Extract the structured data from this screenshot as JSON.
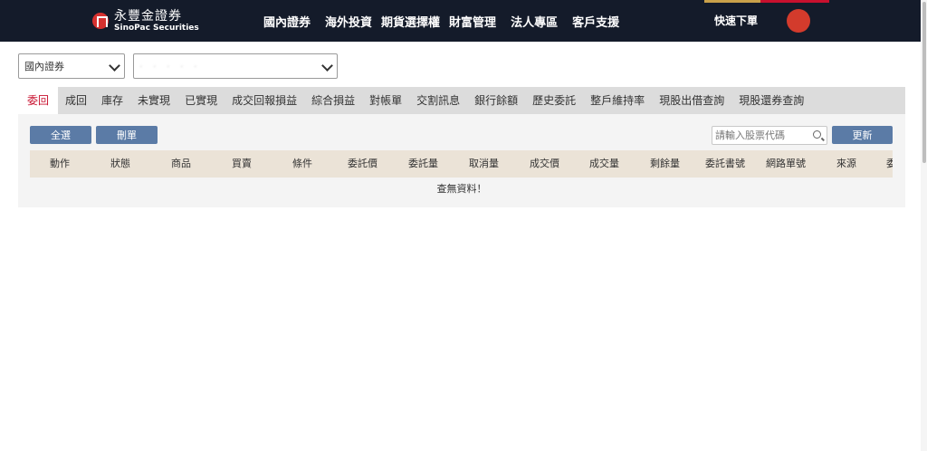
{
  "brand": {
    "name_cn": "永豐金證券",
    "name_en": "SinoPac Securities"
  },
  "nav": [
    "國內證券",
    "海外投資",
    "期貨選擇權",
    "財富管理",
    "法人專區",
    "客戶支援"
  ],
  "header_actions": {
    "quick_order": "快速下單"
  },
  "filters": {
    "market_value": "國內證券",
    "account_value": "·  ·  ·  ·  ·"
  },
  "tabs": [
    "委回",
    "成回",
    "庫存",
    "未實現",
    "已實現",
    "成交回報損益",
    "綜合損益",
    "對帳單",
    "交割訊息",
    "銀行餘額",
    "歷史委託",
    "整戶維持率",
    "現股出借查詢",
    "現股還券查詢"
  ],
  "toolbar": {
    "select_all": "全選",
    "delete": "刪單",
    "search_placeholder": "請輸入股票代碼",
    "refresh": "更新"
  },
  "table": {
    "columns": [
      "動作",
      "狀態",
      "商品",
      "買賣",
      "條件",
      "委託價",
      "委託量",
      "取消量",
      "成交價",
      "成交量",
      "剩餘量",
      "委託書號",
      "網路單號",
      "來源",
      "委"
    ],
    "empty_message": "查無資料！"
  },
  "colors": {
    "nav_bg": "#141b2a",
    "accent_red": "#c8102e",
    "accent_gold": "#c9a14a",
    "button_blue": "#5b7ba6",
    "header_beige": "#ebe3d7"
  }
}
